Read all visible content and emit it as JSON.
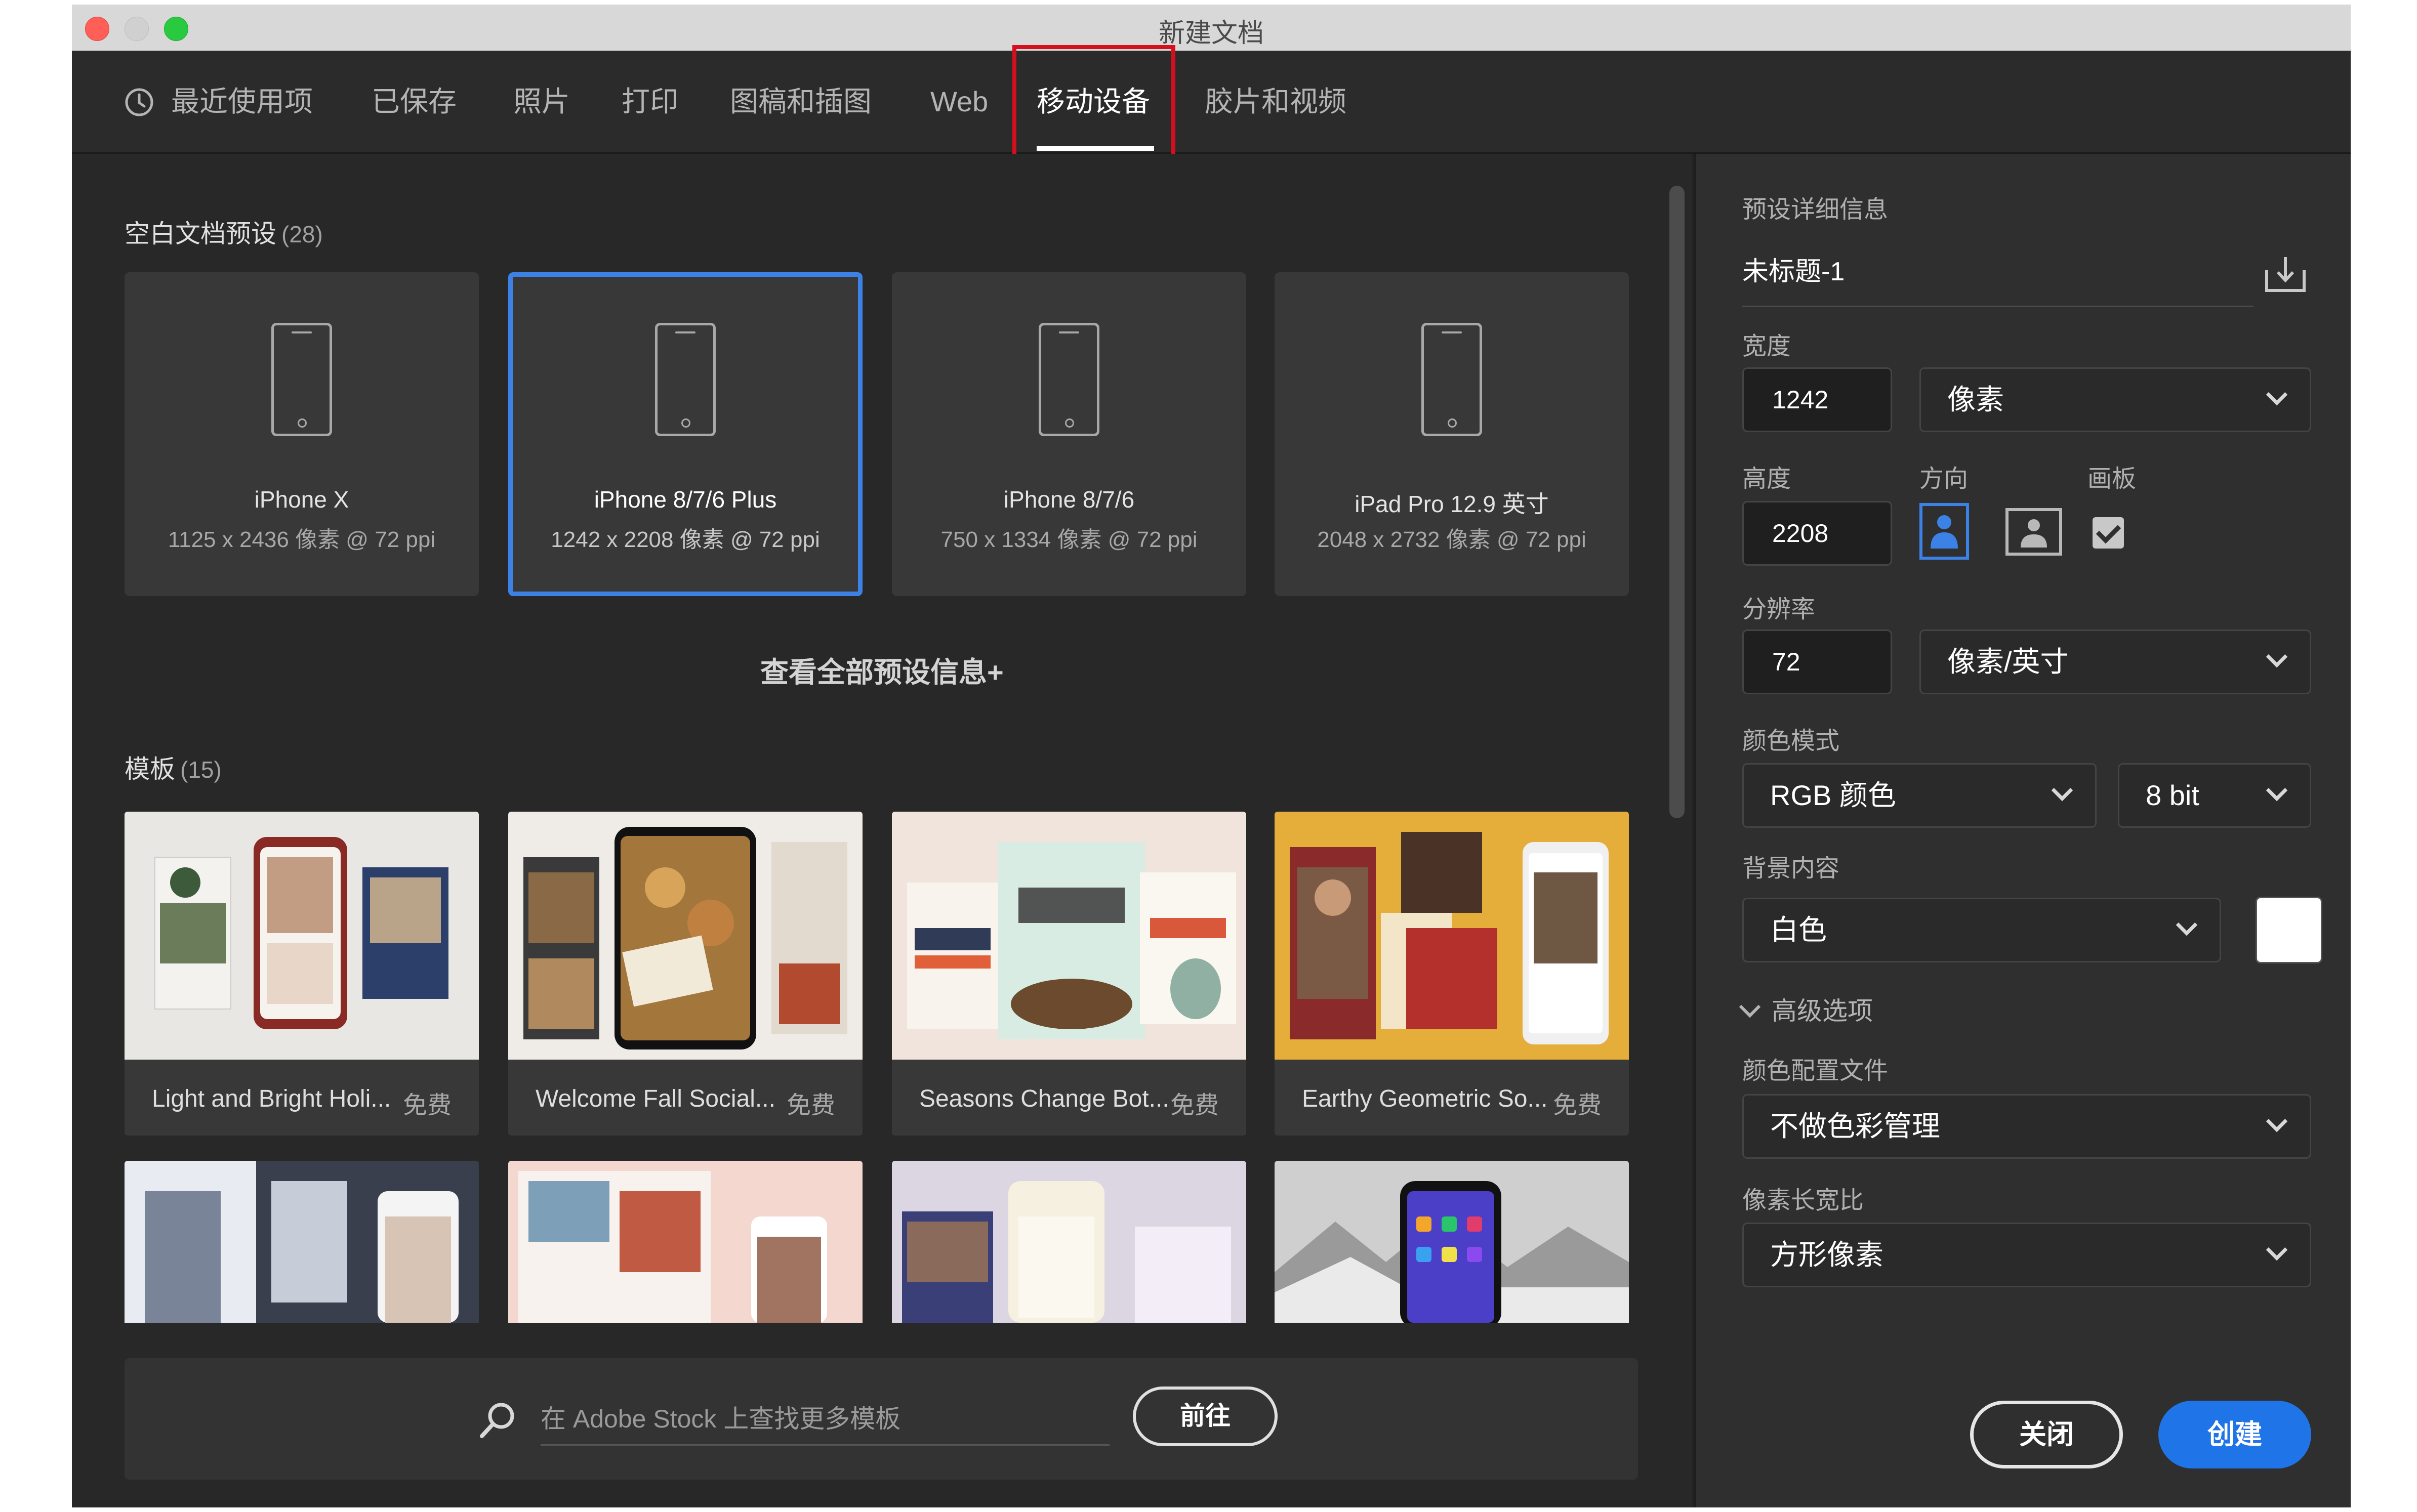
{
  "window": {
    "title": "新建文档"
  },
  "tabs": [
    {
      "label": "最近使用项",
      "icon": "clock-icon"
    },
    {
      "label": "已保存"
    },
    {
      "label": "照片"
    },
    {
      "label": "打印"
    },
    {
      "label": "图稿和插图"
    },
    {
      "label": "Web"
    },
    {
      "label": "移动设备",
      "active": true
    },
    {
      "label": "胶片和视频"
    }
  ],
  "blank_presets": {
    "title": "空白文档预设",
    "count": "(28)",
    "items": [
      {
        "name": "iPhone X",
        "dims": "1125 x 2436 像素 @ 72 ppi"
      },
      {
        "name": "iPhone 8/7/6 Plus",
        "dims": "1242 x 2208 像素 @ 72 ppi",
        "selected": true
      },
      {
        "name": "iPhone 8/7/6",
        "dims": "750 x 1334 像素 @ 72 ppi"
      },
      {
        "name": "iPad Pro 12.9 英寸",
        "dims": "2048 x 2732 像素 @ 72 ppi"
      }
    ],
    "view_all": "查看全部预设信息+"
  },
  "templates": {
    "title": "模板",
    "count": "(15)",
    "items": [
      {
        "name": "Light and Bright Holi...",
        "price": "免费"
      },
      {
        "name": "Welcome Fall Social...",
        "price": "免费"
      },
      {
        "name": "Seasons Change Bot...",
        "price": "免费"
      },
      {
        "name": "Earthy Geometric So...",
        "price": "免费"
      }
    ]
  },
  "stock": {
    "placeholder": "在 Adobe Stock 上查找更多模板",
    "go_label": "前往"
  },
  "details": {
    "title": "预设详细信息",
    "doc_name": "未标题-1",
    "width_label": "宽度",
    "width_value": "1242",
    "width_unit": "像素",
    "height_label": "高度",
    "height_value": "2208",
    "orientation_label": "方向",
    "artboard_label": "画板",
    "artboard_checked": true,
    "resolution_label": "分辨率",
    "resolution_value": "72",
    "resolution_unit": "像素/英寸",
    "color_mode_label": "颜色模式",
    "color_mode": "RGB 颜色",
    "bit_depth": "8 bit",
    "background_label": "背景内容",
    "background": "白色",
    "background_swatch": "#ffffff",
    "advanced": "高级选项",
    "color_profile_label": "颜色配置文件",
    "color_profile": "不做色彩管理",
    "pixel_aspect_label": "像素长宽比",
    "pixel_aspect": "方形像素"
  },
  "actions": {
    "close": "关闭",
    "create": "创建"
  },
  "colors": {
    "accent": "#1f74e8",
    "selected_border": "#3c82e6",
    "highlight": "#d50f1d"
  }
}
